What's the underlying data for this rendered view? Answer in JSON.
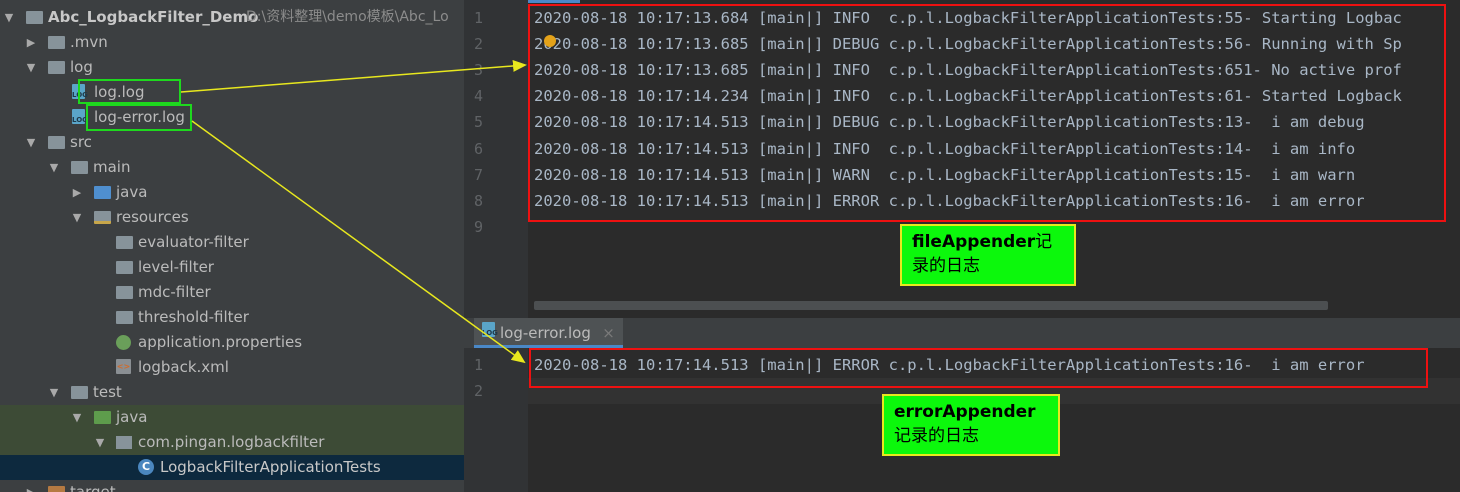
{
  "tree": {
    "root": {
      "name": "Abc_LogbackFilter_Demo",
      "path": "D:\\资料整理\\demo模板\\Abc_Lo"
    },
    "items": [
      {
        "label": ".mvn"
      },
      {
        "label": "log"
      },
      {
        "label": "log.log"
      },
      {
        "label": "log-error.log"
      },
      {
        "label": "src"
      },
      {
        "label": "main"
      },
      {
        "label": "java"
      },
      {
        "label": "resources"
      },
      {
        "label": "evaluator-filter"
      },
      {
        "label": "level-filter"
      },
      {
        "label": "mdc-filter"
      },
      {
        "label": "threshold-filter"
      },
      {
        "label": "application.properties"
      },
      {
        "label": "logback.xml"
      },
      {
        "label": "test"
      },
      {
        "label": "java"
      },
      {
        "label": "com.pingan.logbackfilter"
      },
      {
        "label": "LogbackFilterApplicationTests"
      },
      {
        "label": "target"
      }
    ]
  },
  "editor_top": {
    "line_numbers": [
      "1",
      "2",
      "3",
      "4",
      "5",
      "6",
      "7",
      "8",
      "9"
    ],
    "lines": [
      "2020-08-18 10:17:13.684 [main|] INFO  c.p.l.LogbackFilterApplicationTests:55- Starting Logbac",
      "2020-08-18 10:17:13.685 [main|] DEBUG c.p.l.LogbackFilterApplicationTests:56- Running with Sp",
      "2020-08-18 10:17:13.685 [main|] INFO  c.p.l.LogbackFilterApplicationTests:651- No active prof",
      "2020-08-18 10:17:14.234 [main|] INFO  c.p.l.LogbackFilterApplicationTests:61- Started Logback",
      "2020-08-18 10:17:14.513 [main|] DEBUG c.p.l.LogbackFilterApplicationTests:13-  i am debug",
      "2020-08-18 10:17:14.513 [main|] INFO  c.p.l.LogbackFilterApplicationTests:14-  i am info",
      "2020-08-18 10:17:14.513 [main|] WARN  c.p.l.LogbackFilterApplicationTests:15-  i am warn",
      "2020-08-18 10:17:14.513 [main|] ERROR c.p.l.LogbackFilterApplicationTests:16-  i am error",
      ""
    ]
  },
  "editor_bottom": {
    "tab_label": "log-error.log",
    "tab_close": "×",
    "line_numbers": [
      "1",
      "2"
    ],
    "lines": [
      "2020-08-18 10:17:14.513 [main|] ERROR c.p.l.LogbackFilterApplicationTests:16-  i am error",
      ""
    ]
  },
  "annotations": {
    "file_appender": {
      "bold": "fileAppender",
      "rest1": "记",
      "rest2": "录的日志"
    },
    "error_appender": {
      "bold": "errorAppender",
      "rest": "记录的日志"
    }
  },
  "colors": {
    "annotation_box": "#0cf80c",
    "annotation_border": "#e8e81e",
    "highlight_red": "#ee1111",
    "highlight_green": "#1ed81e",
    "arrow": "#e8e81e"
  }
}
